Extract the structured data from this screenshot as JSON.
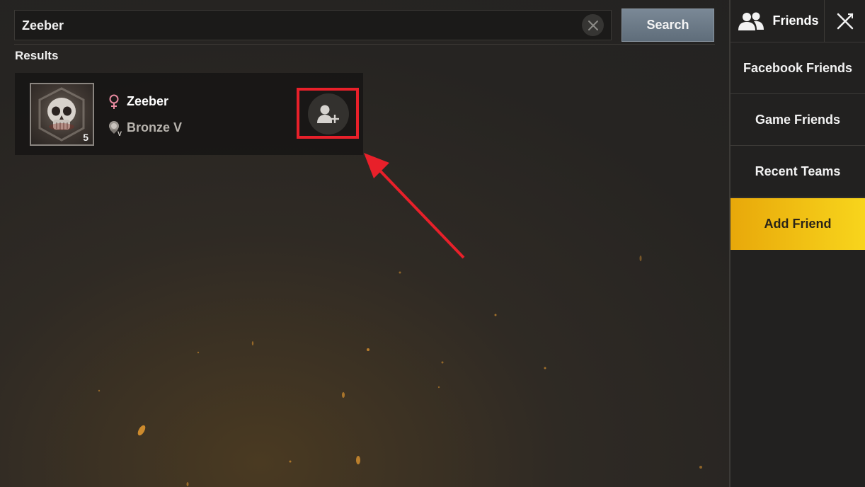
{
  "search": {
    "value": "Zeeber",
    "button_label": "Search",
    "clear_icon": "close-icon"
  },
  "results": {
    "label": "Results",
    "items": [
      {
        "name": "Zeeber",
        "gender_icon": "female-icon",
        "rank": "Bronze V",
        "rank_icon": "bronze-rank-icon",
        "level": "5",
        "avatar_icon": "skull-avatar",
        "action_icon": "add-friend-icon"
      }
    ]
  },
  "side_panel": {
    "header_title": "Friends",
    "header_icon": "friends-icon",
    "close_icon": "close-icon",
    "nav": [
      {
        "label": "Facebook Friends",
        "active": false
      },
      {
        "label": "Game Friends",
        "active": false
      },
      {
        "label": "Recent Teams",
        "active": false
      },
      {
        "label": "Add Friend",
        "active": true
      }
    ]
  },
  "colors": {
    "accent": "#f8d51c",
    "highlight": "#e8202a",
    "female": "#e88aa0"
  }
}
